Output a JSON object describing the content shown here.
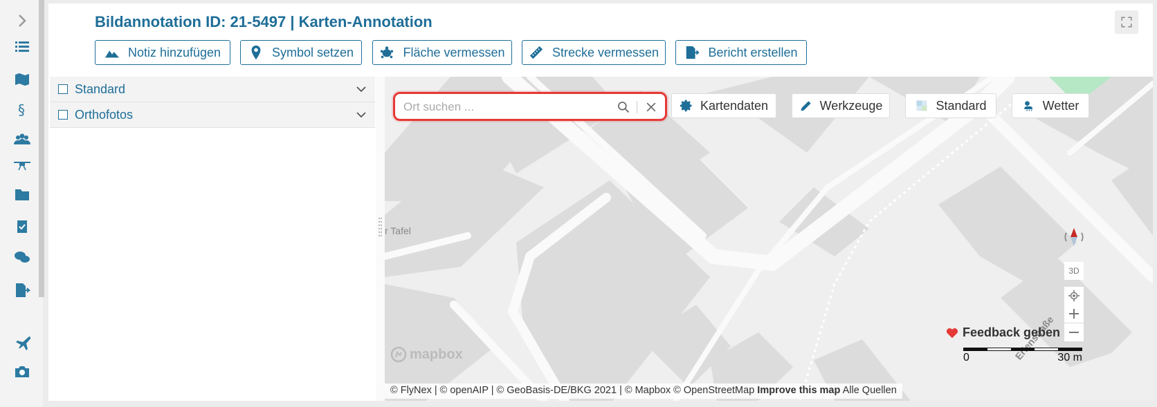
{
  "sidebar": {
    "items": [
      {
        "icon": "chevron-right-icon"
      },
      {
        "icon": "list-icon"
      },
      {
        "icon": "map-plane-icon"
      },
      {
        "icon": "paragraph-icon"
      },
      {
        "icon": "users-icon"
      },
      {
        "icon": "drone-icon"
      },
      {
        "icon": "folder-icon"
      },
      {
        "icon": "clipboard-check-icon"
      },
      {
        "icon": "comments-icon"
      },
      {
        "icon": "file-export-icon"
      },
      {
        "icon": "plane-icon"
      },
      {
        "icon": "camera-icon"
      }
    ]
  },
  "header": {
    "title": "Bildannotation ID: 21-5497 | Karten-Annotation"
  },
  "toolbar": {
    "buttons": [
      {
        "label": "Notiz hinzufügen",
        "icon": "mountain-note-icon"
      },
      {
        "label": "Symbol setzen",
        "icon": "map-marker-icon"
      },
      {
        "label": "Fläche vermessen",
        "icon": "turtle-area-icon"
      },
      {
        "label": "Strecke vermessen",
        "icon": "ruler-icon"
      },
      {
        "label": "Bericht erstellen",
        "icon": "file-export-icon"
      }
    ]
  },
  "layers": {
    "items": [
      {
        "label": "Standard",
        "checked": false
      },
      {
        "label": "Orthofotos",
        "checked": false
      }
    ]
  },
  "map": {
    "search": {
      "placeholder": "Ort suchen ..."
    },
    "buttons": [
      {
        "label": "Kartendaten",
        "icon": "gear-icon"
      },
      {
        "label": "Werkzeuge",
        "icon": "pencil-icon"
      },
      {
        "label": "Standard",
        "icon": "basemap-icon"
      },
      {
        "label": "Wetter",
        "icon": "weather-icon"
      }
    ],
    "place_label": "r Tafel",
    "street_label": "Erlenstraße",
    "controls": {
      "three_d": "3D"
    },
    "feedback": "Feedback geben",
    "scale": {
      "start": "0",
      "end": "30 m"
    },
    "logo": "mapbox",
    "attribution": {
      "text": "© FlyNex | © openAIP | © GeoBasis-DE/BKG 2021 | © Mapbox © OpenStreetMap",
      "improve": "Improve this map",
      "sources": "Alle Quellen"
    },
    "colors": {
      "highlight": "#e53935",
      "accent": "#1e6e98"
    }
  }
}
